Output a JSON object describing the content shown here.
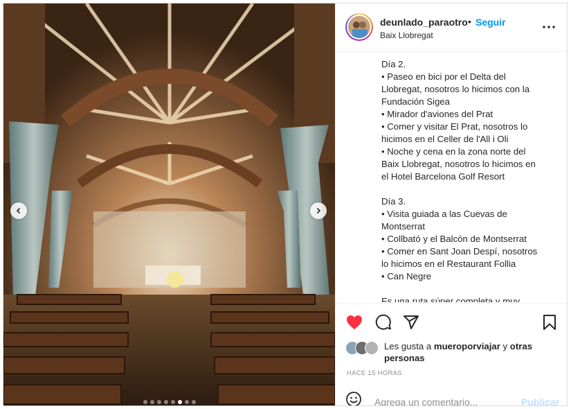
{
  "post": {
    "username": "deunlado_paraotro",
    "separator": "•",
    "follow_label": "Seguir",
    "location": "Baix Llobregat",
    "more_icon": "more-horizontal-icon"
  },
  "photo": {
    "prev_icon": "chevron-left-icon",
    "next_icon": "chevron-right-icon",
    "dot_count": 8,
    "active_dot": 5
  },
  "caption": {
    "lines": [
      "Día 2.",
      "• Paseo en bici por el Delta del",
      "Llobregat, nosotros lo hicimos con la",
      "Fundación Sigea",
      "• Mirador d'aviones del Prat",
      "• Comer y visitar El Prat, nosotros lo",
      "hicimos en el Celler de l'All i Oli",
      "• Noche y cena en la zona norte del",
      "Baix Llobregat, nosotros lo hicimos en",
      "el Hotel Barcelona Golf Resort",
      "",
      "Día 3.",
      "• Visita guiada a las Cuevas de",
      "Montserrat",
      "• Collbató y el Balcón de Montserrat",
      "• Comer en Sant Joan Despí, nosotros",
      "lo hicimos en el Restaurant Follia",
      "• Can Negre",
      "",
      "Es una ruta súper completa y muy"
    ]
  },
  "actions": {
    "like_icon": "heart-filled-icon",
    "comment_icon": "comment-icon",
    "share_icon": "send-icon",
    "save_icon": "bookmark-icon",
    "like_color": "#ff3040"
  },
  "likes": {
    "prefix": "Les gusta a ",
    "user": "mueroporviajar",
    "middle": " y ",
    "others_1": "otras",
    "others_2": "personas"
  },
  "timestamp": "HACE 15 HORAS",
  "comment": {
    "emoji_icon": "emoji-icon",
    "placeholder": "Agrega un comentario...",
    "publish_label": "Publicar"
  },
  "colors": {
    "accent": "#0095f6",
    "publish_disabled": "#c0dffd",
    "muted": "#8e8e8e"
  }
}
